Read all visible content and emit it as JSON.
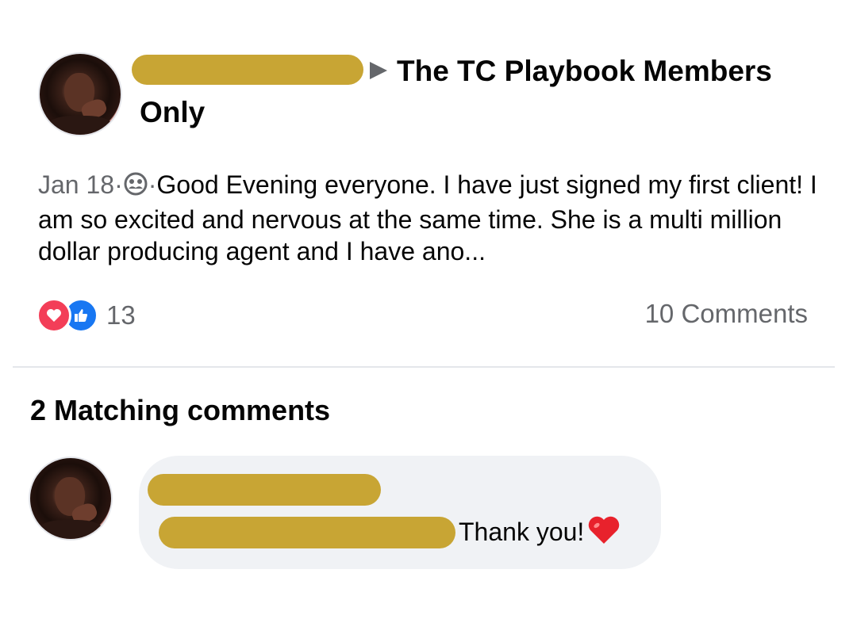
{
  "post": {
    "group_name": "The TC Playbook Members Only",
    "date": "Jan 18",
    "separator": "·",
    "audience_icon": "group-members-icon",
    "text": "Good Evening everyone. I have just signed my first client! I am so excited and nervous at the same time. She is a multi million dollar producing agent and I have ano...",
    "reaction_icons": [
      "love-reaction-icon",
      "like-reaction-icon"
    ],
    "reaction_count": "13",
    "comments_count": "10 Comments"
  },
  "matching": {
    "heading": "2 Matching comments"
  },
  "comment": {
    "text": "Thank you!",
    "emoji": "red-heart-icon"
  },
  "colors": {
    "redaction": "#c8a534",
    "love": "#f33e58",
    "like": "#1877f2",
    "muted_text": "#65676b",
    "bubble": "#f0f2f5"
  }
}
